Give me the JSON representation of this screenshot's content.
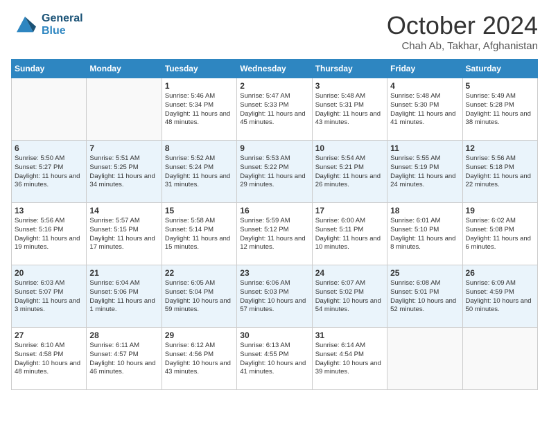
{
  "header": {
    "logo_general": "General",
    "logo_blue": "Blue",
    "title": "October 2024",
    "location": "Chah Ab, Takhar, Afghanistan"
  },
  "weekdays": [
    "Sunday",
    "Monday",
    "Tuesday",
    "Wednesday",
    "Thursday",
    "Friday",
    "Saturday"
  ],
  "weeks": [
    [
      {
        "day": "",
        "info": ""
      },
      {
        "day": "",
        "info": ""
      },
      {
        "day": "1",
        "info": "Sunrise: 5:46 AM\nSunset: 5:34 PM\nDaylight: 11 hours and 48 minutes."
      },
      {
        "day": "2",
        "info": "Sunrise: 5:47 AM\nSunset: 5:33 PM\nDaylight: 11 hours and 45 minutes."
      },
      {
        "day": "3",
        "info": "Sunrise: 5:48 AM\nSunset: 5:31 PM\nDaylight: 11 hours and 43 minutes."
      },
      {
        "day": "4",
        "info": "Sunrise: 5:48 AM\nSunset: 5:30 PM\nDaylight: 11 hours and 41 minutes."
      },
      {
        "day": "5",
        "info": "Sunrise: 5:49 AM\nSunset: 5:28 PM\nDaylight: 11 hours and 38 minutes."
      }
    ],
    [
      {
        "day": "6",
        "info": "Sunrise: 5:50 AM\nSunset: 5:27 PM\nDaylight: 11 hours and 36 minutes."
      },
      {
        "day": "7",
        "info": "Sunrise: 5:51 AM\nSunset: 5:25 PM\nDaylight: 11 hours and 34 minutes."
      },
      {
        "day": "8",
        "info": "Sunrise: 5:52 AM\nSunset: 5:24 PM\nDaylight: 11 hours and 31 minutes."
      },
      {
        "day": "9",
        "info": "Sunrise: 5:53 AM\nSunset: 5:22 PM\nDaylight: 11 hours and 29 minutes."
      },
      {
        "day": "10",
        "info": "Sunrise: 5:54 AM\nSunset: 5:21 PM\nDaylight: 11 hours and 26 minutes."
      },
      {
        "day": "11",
        "info": "Sunrise: 5:55 AM\nSunset: 5:19 PM\nDaylight: 11 hours and 24 minutes."
      },
      {
        "day": "12",
        "info": "Sunrise: 5:56 AM\nSunset: 5:18 PM\nDaylight: 11 hours and 22 minutes."
      }
    ],
    [
      {
        "day": "13",
        "info": "Sunrise: 5:56 AM\nSunset: 5:16 PM\nDaylight: 11 hours and 19 minutes."
      },
      {
        "day": "14",
        "info": "Sunrise: 5:57 AM\nSunset: 5:15 PM\nDaylight: 11 hours and 17 minutes."
      },
      {
        "day": "15",
        "info": "Sunrise: 5:58 AM\nSunset: 5:14 PM\nDaylight: 11 hours and 15 minutes."
      },
      {
        "day": "16",
        "info": "Sunrise: 5:59 AM\nSunset: 5:12 PM\nDaylight: 11 hours and 12 minutes."
      },
      {
        "day": "17",
        "info": "Sunrise: 6:00 AM\nSunset: 5:11 PM\nDaylight: 11 hours and 10 minutes."
      },
      {
        "day": "18",
        "info": "Sunrise: 6:01 AM\nSunset: 5:10 PM\nDaylight: 11 hours and 8 minutes."
      },
      {
        "day": "19",
        "info": "Sunrise: 6:02 AM\nSunset: 5:08 PM\nDaylight: 11 hours and 6 minutes."
      }
    ],
    [
      {
        "day": "20",
        "info": "Sunrise: 6:03 AM\nSunset: 5:07 PM\nDaylight: 11 hours and 3 minutes."
      },
      {
        "day": "21",
        "info": "Sunrise: 6:04 AM\nSunset: 5:06 PM\nDaylight: 11 hours and 1 minute."
      },
      {
        "day": "22",
        "info": "Sunrise: 6:05 AM\nSunset: 5:04 PM\nDaylight: 10 hours and 59 minutes."
      },
      {
        "day": "23",
        "info": "Sunrise: 6:06 AM\nSunset: 5:03 PM\nDaylight: 10 hours and 57 minutes."
      },
      {
        "day": "24",
        "info": "Sunrise: 6:07 AM\nSunset: 5:02 PM\nDaylight: 10 hours and 54 minutes."
      },
      {
        "day": "25",
        "info": "Sunrise: 6:08 AM\nSunset: 5:01 PM\nDaylight: 10 hours and 52 minutes."
      },
      {
        "day": "26",
        "info": "Sunrise: 6:09 AM\nSunset: 4:59 PM\nDaylight: 10 hours and 50 minutes."
      }
    ],
    [
      {
        "day": "27",
        "info": "Sunrise: 6:10 AM\nSunset: 4:58 PM\nDaylight: 10 hours and 48 minutes."
      },
      {
        "day": "28",
        "info": "Sunrise: 6:11 AM\nSunset: 4:57 PM\nDaylight: 10 hours and 46 minutes."
      },
      {
        "day": "29",
        "info": "Sunrise: 6:12 AM\nSunset: 4:56 PM\nDaylight: 10 hours and 43 minutes."
      },
      {
        "day": "30",
        "info": "Sunrise: 6:13 AM\nSunset: 4:55 PM\nDaylight: 10 hours and 41 minutes."
      },
      {
        "day": "31",
        "info": "Sunrise: 6:14 AM\nSunset: 4:54 PM\nDaylight: 10 hours and 39 minutes."
      },
      {
        "day": "",
        "info": ""
      },
      {
        "day": "",
        "info": ""
      }
    ]
  ]
}
